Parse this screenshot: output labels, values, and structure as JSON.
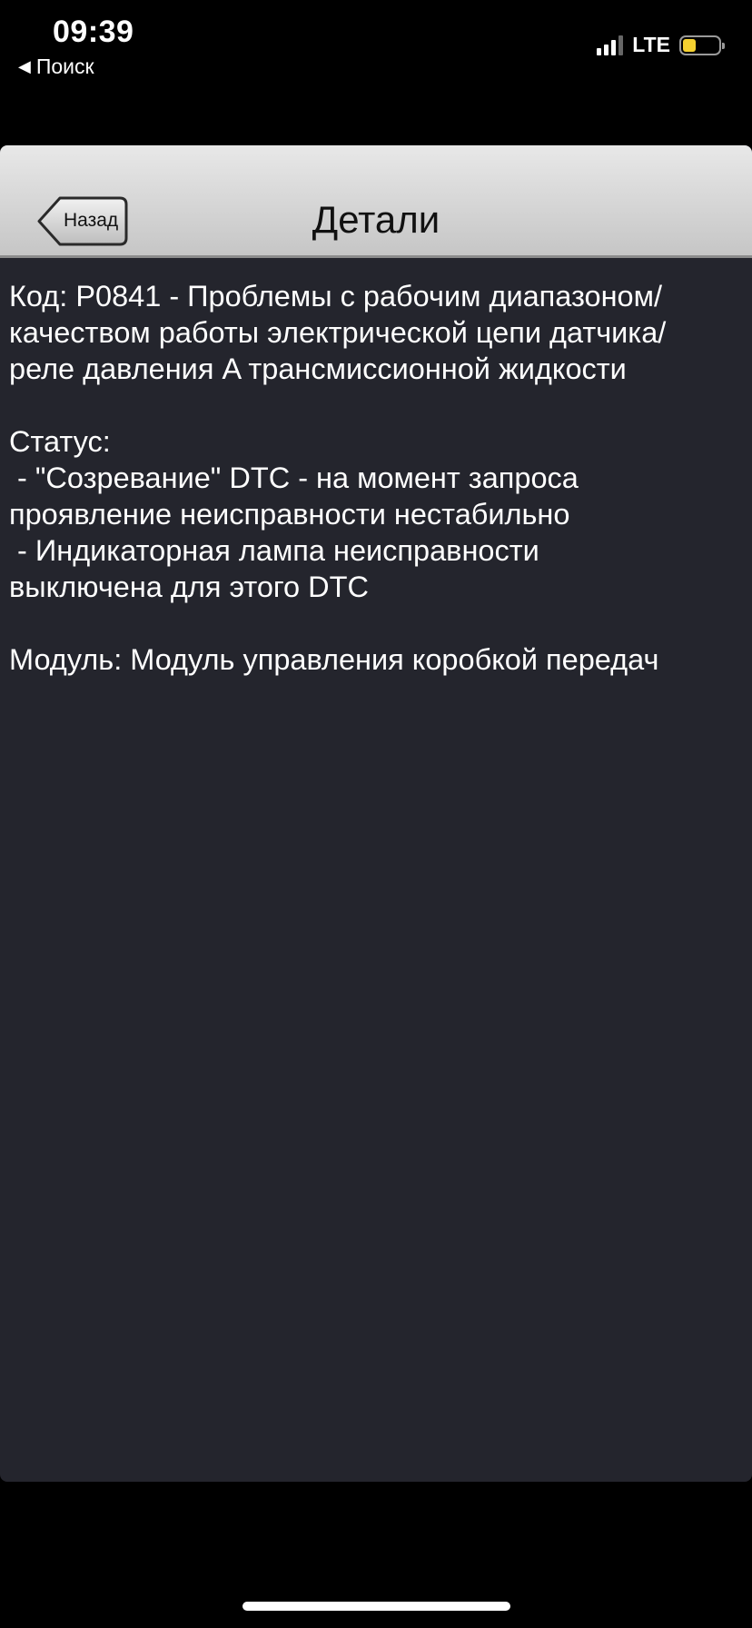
{
  "status_bar": {
    "time": "09:39",
    "back_app": "Поиск",
    "network": "LTE",
    "battery_color": "#f5d130"
  },
  "nav": {
    "title": "Детали",
    "back_label": "Назад"
  },
  "details": {
    "code_lines": [
      "Код: P0841 - Проблемы с рабочим диапазоном/",
      "качеством работы электрической цепи датчика/",
      "реле давления A трансмиссионной жидкости"
    ],
    "status_lines": [
      "Статус:",
      " - \"Созревание\" DTC - на момент запроса",
      "проявление неисправности нестабильно",
      " - Индикаторная лампа неисправности",
      "выключена для этого DTC"
    ],
    "module": "Модуль: Модуль управления коробкой передач"
  }
}
